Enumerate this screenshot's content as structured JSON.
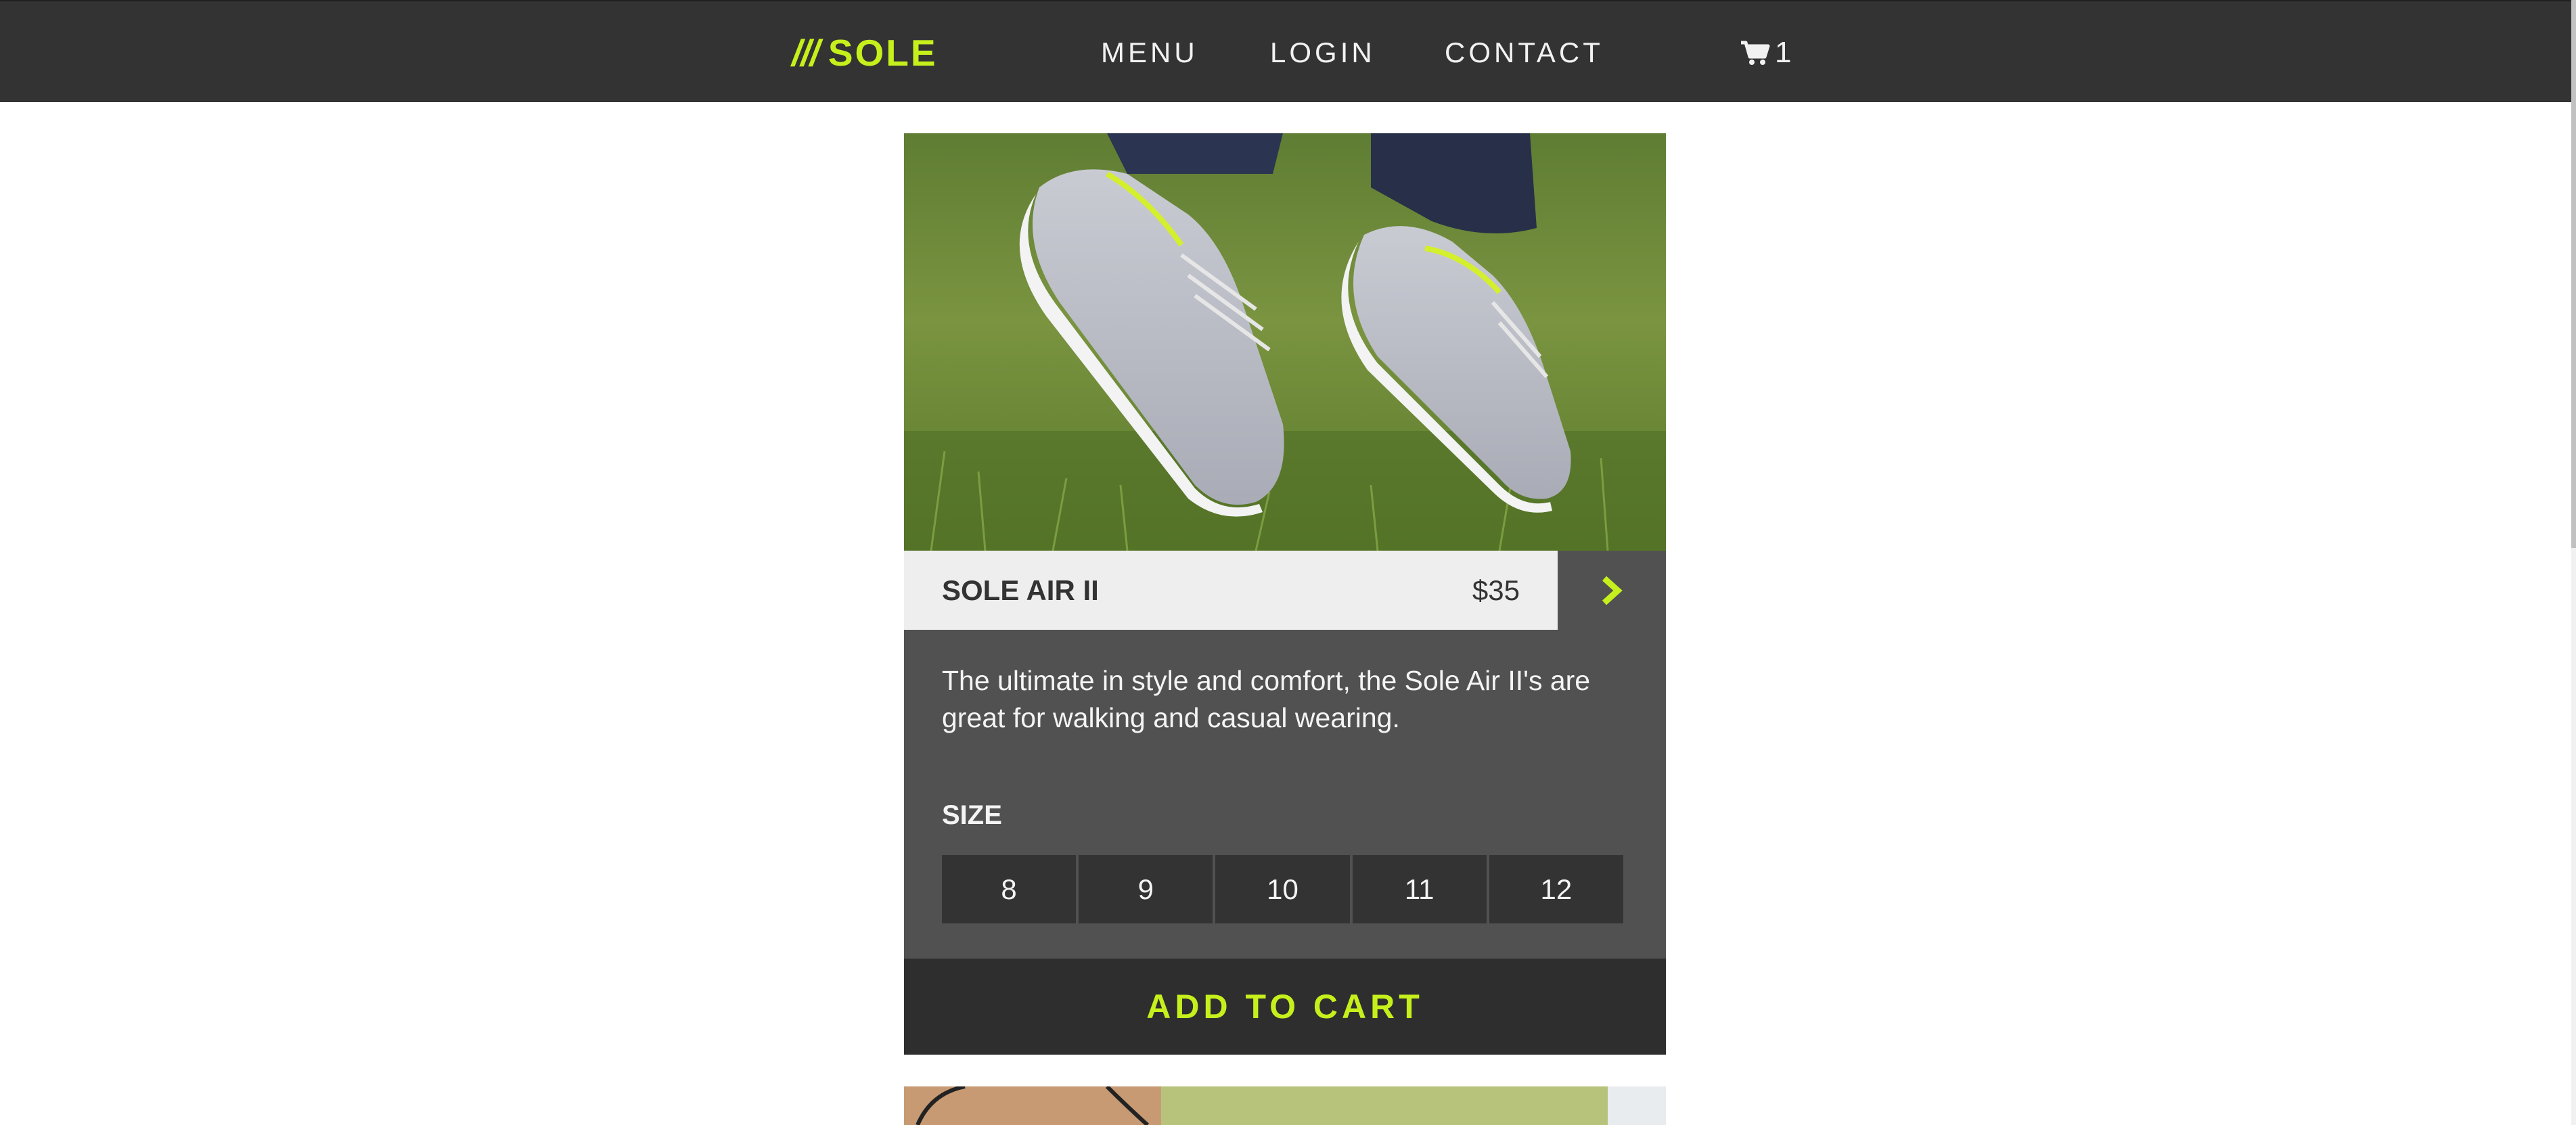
{
  "header": {
    "brand_mark": "///",
    "brand_name": "SOLE",
    "nav": [
      "MENU",
      "LOGIN",
      "CONTACT"
    ],
    "cart_count": "1",
    "cart_icon": "cart-icon"
  },
  "product": {
    "name": "SOLE AIR II",
    "price": "$35",
    "next_icon": "chevron-right-icon",
    "description": "The ultimate in style and comfort, the Sole Air II's are great for walking and casual wearing.",
    "size_label": "SIZE",
    "sizes": [
      "8",
      "9",
      "10",
      "11",
      "12"
    ],
    "add_to_cart_label": "ADD TO CART"
  },
  "colors": {
    "accent": "#c6f01c",
    "dark": "#333333",
    "panel": "#515151",
    "light": "#eeeeee"
  }
}
